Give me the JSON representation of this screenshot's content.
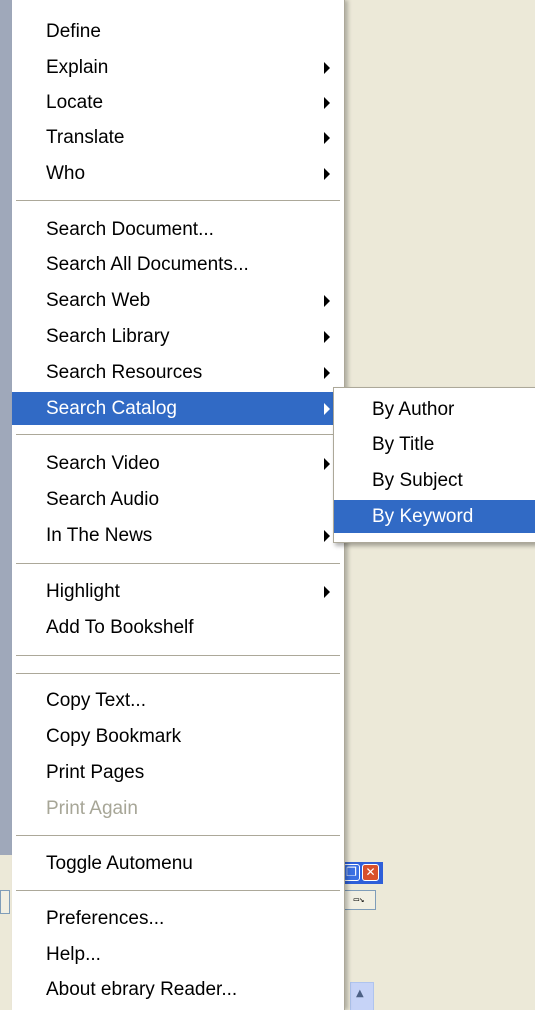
{
  "menu": {
    "items": [
      {
        "label": "Define"
      },
      {
        "label": "Explain"
      },
      {
        "label": "Locate"
      },
      {
        "label": "Translate"
      },
      {
        "label": "Who"
      },
      {
        "label": "Search Document..."
      },
      {
        "label": "Search All Documents..."
      },
      {
        "label": "Search Web"
      },
      {
        "label": "Search Library"
      },
      {
        "label": "Search Resources"
      },
      {
        "label": "Search Catalog"
      },
      {
        "label": "Search Video"
      },
      {
        "label": "Search Audio"
      },
      {
        "label": "In The News"
      },
      {
        "label": "Highlight"
      },
      {
        "label": "Add To Bookshelf"
      },
      {
        "label": "Copy Text..."
      },
      {
        "label": "Copy Bookmark"
      },
      {
        "label": "Print Pages"
      },
      {
        "label": "Print Again"
      },
      {
        "label": "Toggle Automenu"
      },
      {
        "label": "Preferences..."
      },
      {
        "label": "Help..."
      },
      {
        "label": "About ebrary Reader..."
      }
    ]
  },
  "submenu": {
    "items": [
      {
        "label": "By Author"
      },
      {
        "label": "By Title"
      },
      {
        "label": "By Subject"
      },
      {
        "label": "By Keyword"
      }
    ]
  },
  "colors": {
    "highlight": "#316AC5",
    "menu_background": "#FFFFFF",
    "desktop": "#ECE9D8",
    "disabled_text": "#A7A697"
  }
}
